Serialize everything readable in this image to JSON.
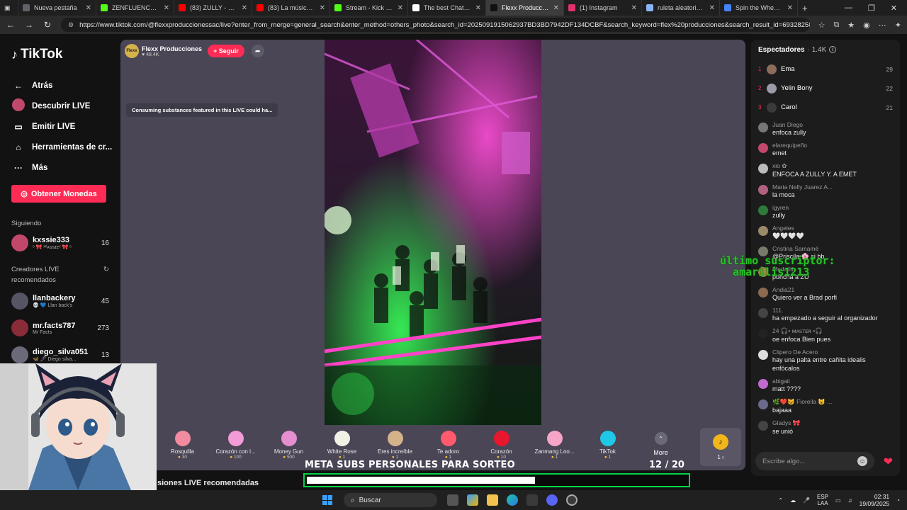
{
  "browser": {
    "tabs": [
      {
        "label": "Nueva pestaña",
        "color": "#5f6368",
        "active": false
      },
      {
        "label": "ZENFLUENCER Stre",
        "color": "#53fc18",
        "active": false
      },
      {
        "label": "(83) ZULLY - Las Bo",
        "color": "#ff0000",
        "active": false
      },
      {
        "label": "(83) La música de l",
        "color": "#ff0000",
        "active": false
      },
      {
        "label": "Stream - Kick Dash",
        "color": "#53fc18",
        "active": false
      },
      {
        "label": "The best ChatBot a",
        "color": "#ffffff",
        "active": false
      },
      {
        "label": "Flexx Produccione",
        "color": "#111111",
        "active": true
      },
      {
        "label": "(1) Instagram",
        "color": "#e1306c",
        "active": false
      },
      {
        "label": "ruleta aleatoria onli",
        "color": "#8ab4f8",
        "active": false
      },
      {
        "label": "Spin the Wheel - Fr",
        "color": "#4285f4",
        "active": false
      }
    ],
    "url": "https://www.tiktok.com/@flexxproduccionessac/live?enter_from_merge=general_search&enter_method=others_photo&search_id=2025091915062937BD3BD7942DF134DCBF&search_keyword=flex%20producciones&search_result_id=69328258160..."
  },
  "sidebar": {
    "logo": "TikTok",
    "back": "Atrás",
    "nav": [
      {
        "label": "Descubrir LIVE",
        "icon": "live-avatar-icon"
      },
      {
        "label": "Emitir LIVE",
        "icon": "video-camera-icon"
      },
      {
        "label": "Herramientas de cr...",
        "icon": "creator-tools-icon"
      },
      {
        "label": "Más",
        "icon": "more-dots-icon"
      }
    ],
    "coins_button": "Obtener Monedas",
    "following_title": "Siguiendo",
    "following": [
      {
        "name": "kxssie333",
        "sub": "ᵒ 🎀 ˣᴷᴀꜱꜱɪᴇˣ 🎀 ᵒ",
        "count": "16",
        "color": "#c2486b"
      }
    ],
    "recommended_title": "Creadores LIVE recomendados",
    "recommended": [
      {
        "name": "llanbackery",
        "sub": "💀 💙 Llan back's",
        "count": "45",
        "color": "#555566"
      },
      {
        "name": "mr.facts787",
        "sub": "Mr Facts",
        "count": "273",
        "color": "#8a2b3a"
      },
      {
        "name": "diego_silva051",
        "sub": "🦋 🖊 Diego silva...",
        "count": "13",
        "color": "#6a6a7a"
      }
    ]
  },
  "stream": {
    "host_name": "Flexx Producciones",
    "host_avatar": "Flexx",
    "likes": "♥ 48.4K",
    "follow_button": "+ Seguir",
    "warning": "Consuming substances featured in this LIVE could ha...",
    "gifts": [
      {
        "name": "Rosquilla",
        "price": "30",
        "color": "#f28aa0"
      },
      {
        "name": "Corazón con l...",
        "price": "100",
        "color": "#f39bd6"
      },
      {
        "name": "Money Gun",
        "price": "500",
        "color": "#e58fd0"
      },
      {
        "name": "White Rose",
        "price": "1",
        "color": "#f1f1e6"
      },
      {
        "name": "Eres increíble",
        "price": "1",
        "color": "#d4b38a"
      },
      {
        "name": "Te adoro",
        "price": "1",
        "color": "#ff5a6e"
      },
      {
        "name": "Corazón",
        "price": "10",
        "color": "#e8172d"
      },
      {
        "name": "Zanmang Loo...",
        "price": "1",
        "color": "#f6a5c8"
      },
      {
        "name": "TikTok",
        "price": "1",
        "color": "#1ec8e6"
      }
    ],
    "more_label": "More",
    "coin_label": "1 ›",
    "recommended_bottom": "siones LIVE recomendadas"
  },
  "goal": {
    "title": "META SUBS PERSONALES PARA SORTEO",
    "count": "12  / 20",
    "progress": 0.6
  },
  "chat": {
    "viewers_label": "Espectadores",
    "viewers_count": "· 1.4K",
    "top_viewers": [
      {
        "rank": "1",
        "name": "Ema",
        "score": "29",
        "color": "#8b6d5c"
      },
      {
        "rank": "2",
        "name": "Yelin Bony",
        "score": "22",
        "color": "#9a9aa8"
      },
      {
        "rank": "3",
        "name": "Carol",
        "score": "21",
        "color": "#3a3a3a"
      }
    ],
    "messages": [
      {
        "user": "Juan Diego",
        "text": "enfoca zully",
        "color": "#777"
      },
      {
        "user": "elarequipeño",
        "text": "emet",
        "color": "#c2486b"
      },
      {
        "user": "xio ✿",
        "text": "ENFOCA A ZULLY Y. A EMET",
        "color": "#bbb"
      },
      {
        "user": "Maria Nelly Juarez A...",
        "text": "la moca",
        "color": "#b06080"
      },
      {
        "user": "igyren",
        "text": "zully",
        "color": "#2f7a3a"
      },
      {
        "user": "Angeles",
        "text": "🤍🤍🤍🤍",
        "color": "#9a8a6a"
      },
      {
        "user": "Cristina Samamé",
        "text": "@Priscila 🌸 si bb",
        "color": "#7a7a6a"
      },
      {
        "user": "Medalith",
        "text": "poncha a ZU",
        "color": "#a08a40"
      },
      {
        "user": "Andia21",
        "text": "Quiero ver a Brad porfi",
        "color": "#8a6a50"
      },
      {
        "user": "111.",
        "text": "ha empezado a seguir al organizador",
        "color": "#444"
      },
      {
        "user": "24 🎧• ᴍᴀꜱᴛᴇʀ •🎧",
        "text": "oe enfoca Bien pues",
        "color": "#222"
      },
      {
        "user": "Clipero De Acero",
        "text": "hay una palta entre cañita idealis enfócalos",
        "color": "#ddd"
      },
      {
        "user": "abigait",
        "text": "matt ????",
        "color": "#c06ad0"
      },
      {
        "user": "🌿❤️😺 Fiorella 😺 ...",
        "text": "bajaaa",
        "color": "#6a6a8a"
      },
      {
        "user": "Gladys 🎀",
        "text": "se unió",
        "color": "#444"
      }
    ],
    "input_placeholder": "Escribe algo..."
  },
  "overlay": {
    "last_subscriber": "último suscriptor:\n  amarilis1213"
  },
  "taskbar": {
    "search": "Buscar",
    "lang": "ESP\nLAA",
    "time": "02:31",
    "date": "19/09/2025"
  }
}
